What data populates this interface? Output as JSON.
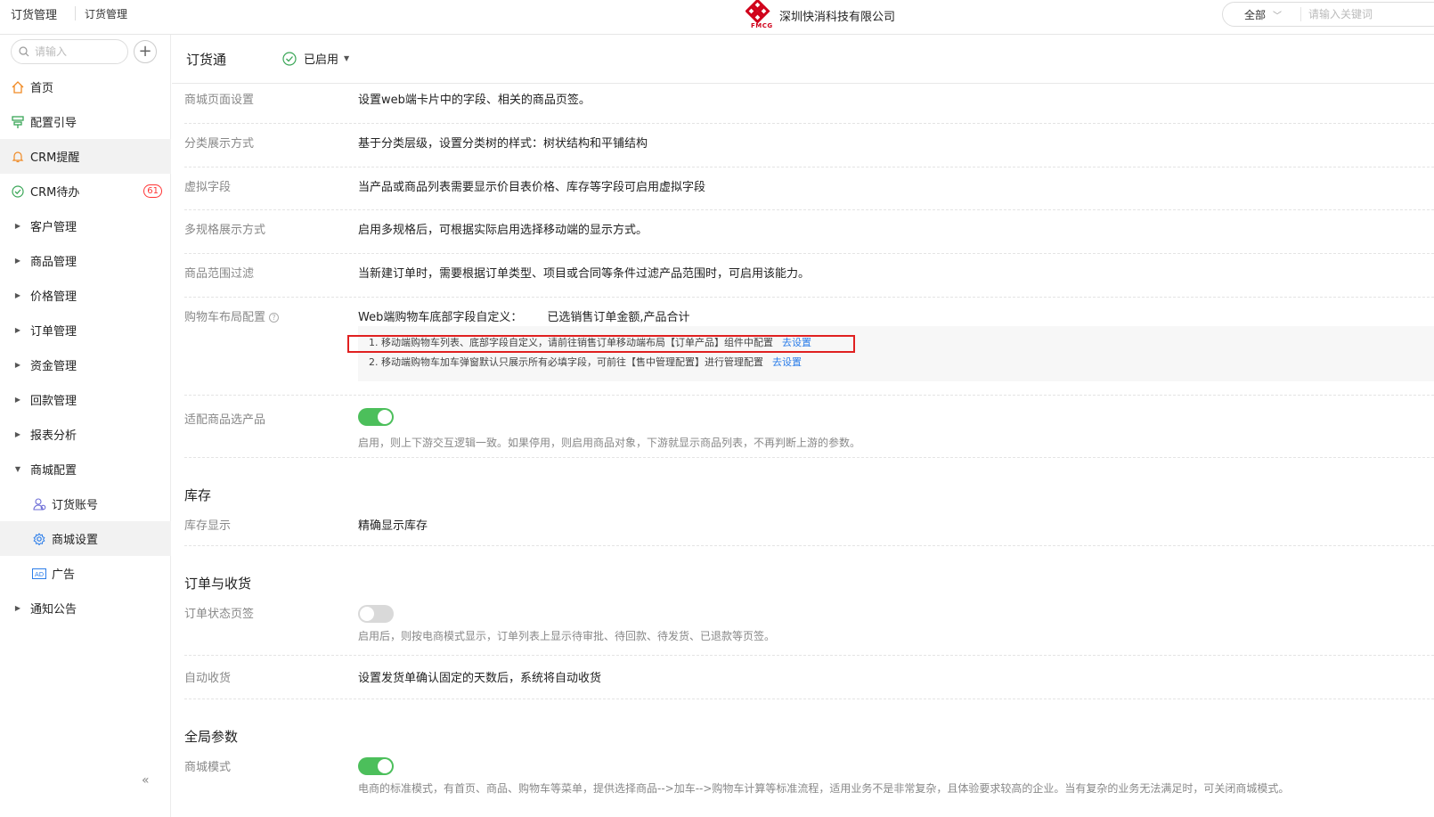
{
  "header": {
    "breadcrumb_1": "订货管理",
    "breadcrumb_2": "订货管理",
    "logo_text": "FMCG",
    "company": "深圳快消科技有限公司",
    "search_scope": "全部",
    "search_placeholder": "请输入关键词"
  },
  "sidebar": {
    "search_placeholder": "请输入",
    "items": [
      {
        "label": "首页",
        "icon": "home-icon"
      },
      {
        "label": "配置引导",
        "icon": "guide-icon"
      },
      {
        "label": "CRM提醒",
        "icon": "bell-icon"
      },
      {
        "label": "CRM待办",
        "icon": "check-circle-icon",
        "badge": "61"
      },
      {
        "label": "客户管理"
      },
      {
        "label": "商品管理"
      },
      {
        "label": "价格管理"
      },
      {
        "label": "订单管理"
      },
      {
        "label": "资金管理"
      },
      {
        "label": "回款管理"
      },
      {
        "label": "报表分析"
      },
      {
        "label": "商城配置"
      },
      {
        "label": "订货账号",
        "icon": "users-icon"
      },
      {
        "label": "商城设置",
        "icon": "gear-icon"
      },
      {
        "label": "广告",
        "icon": "ad-icon"
      },
      {
        "label": "通知公告"
      }
    ],
    "collapse_glyph": "«"
  },
  "main": {
    "title": "订货通",
    "status": "已启用",
    "rows": {
      "mall_page": {
        "label": "商城页面设置",
        "value": "设置web端卡片中的字段、相关的商品页签。"
      },
      "category": {
        "label": "分类展示方式",
        "value": "基于分类层级，设置分类树的样式：树状结构和平铺结构"
      },
      "virtual": {
        "label": "虚拟字段",
        "value": "当产品或商品列表需要显示价目表价格、库存等字段可启用虚拟字段"
      },
      "multispec": {
        "label": "多规格展示方式",
        "value": "启用多规格后，可根据实际启用选择移动端的显示方式。"
      },
      "range_filter": {
        "label": "商品范围过滤",
        "value": "当新建订单时，需要根据订单类型、项目或合同等条件过滤产品范围时，可启用该能力。"
      },
      "cart_layout": {
        "label": "购物车布局配置",
        "value_prefix": "Web端购物车底部字段自定义：",
        "value": "已选销售订单金额,产品合计",
        "tip1": "1. 移动端购物车列表、底部字段自定义，请前往销售订单移动端布局【订单产品】组件中配置",
        "tip1_link": "去设置",
        "tip2": "2. 移动端购物车加车弹窗默认只展示所有必填字段，可前往【售中管理配置】进行管理配置",
        "tip2_link": "去设置"
      },
      "adapt_product": {
        "label": "适配商品选产品",
        "enabled": true,
        "desc": "启用，则上下游交互逻辑一致。如果停用，则启用商品对象，下游就显示商品列表，不再判断上游的参数。"
      }
    },
    "section_stock": "库存",
    "stock_display": {
      "label": "库存显示",
      "value": "精确显示库存"
    },
    "section_order": "订单与收货",
    "order_tabs": {
      "label": "订单状态页签",
      "enabled": false,
      "desc": "启用后，则按电商模式显示，订单列表上显示待审批、待回款、待发货、已退款等页签。"
    },
    "auto_receive": {
      "label": "自动收货",
      "value": "设置发货单确认固定的天数后，系统将自动收货"
    },
    "section_global": "全局参数",
    "mall_mode": {
      "label": "商城模式",
      "enabled": true,
      "desc": "电商的标准模式，有首页、商品、购物车等菜单，提供选择商品-->加车-->购物车计算等标准流程，适用业务不是非常复杂，且体验要求较高的企业。当有复杂的业务无法满足时，可关闭商城模式。"
    }
  },
  "colors": {
    "accent": "#2b7de9",
    "toggle_on": "#4cbf5b",
    "highlight": "#e02020",
    "brand": "#d0021b"
  }
}
